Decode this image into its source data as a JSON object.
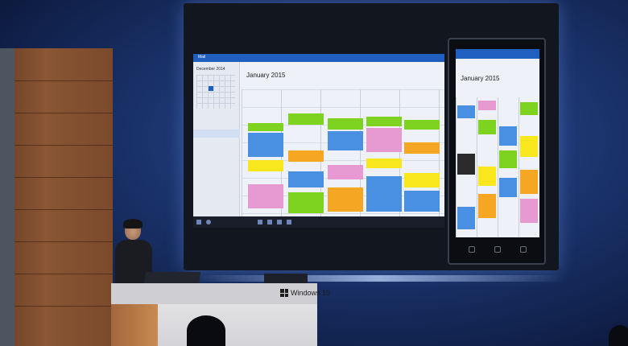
{
  "desktop_calendar": {
    "window_title": "Mail",
    "month_title": "January 2015",
    "mini_month": "December 2014"
  },
  "phone_calendar": {
    "month_title": "January 2015"
  },
  "podium": {
    "brand_text": "Windows 10"
  },
  "colors": {
    "accent": "#1f5fbf",
    "event_green": "#7ed321",
    "event_blue": "#4a90e2",
    "event_orange": "#f5a623",
    "event_pink": "#e79ad1",
    "event_yellow": "#f8e71c"
  }
}
